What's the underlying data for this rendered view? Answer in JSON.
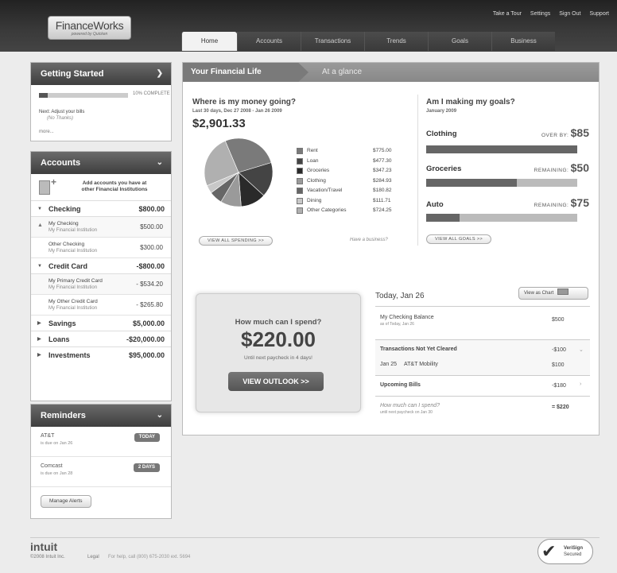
{
  "header": {
    "logo_brand": "FinanceWorks",
    "logo_sub": "powered by Quicken",
    "top_links": [
      "Take a Tour",
      "Settings",
      "Sign Out",
      "Support"
    ],
    "tabs": [
      "Home",
      "Accounts",
      "Transactions",
      "Trends",
      "Goals",
      "Business"
    ]
  },
  "getting_started": {
    "title": "Getting Started",
    "percent": 10,
    "percent_label": "10% COMPLETE",
    "next_label": "Next: Adjust your bills",
    "next_sub": "(No Thanks)",
    "more": "more..."
  },
  "accounts": {
    "title": "Accounts",
    "add_text_1": "Add accounts you have at",
    "add_text_2": "other Financial Institutions",
    "checking": {
      "name": "Checking",
      "amount": "$800.00",
      "subs": [
        {
          "name": "My Checking",
          "inst": "My Financial Institution",
          "amount": "$500.00"
        },
        {
          "name": "Other Checking",
          "inst": "My Financial Institution",
          "amount": "$300.00"
        }
      ]
    },
    "credit": {
      "name": "Credit Card",
      "amount": "-$800.00",
      "subs": [
        {
          "name": "My Primary Credit Card",
          "inst": "My Financial Institution",
          "amount": "- $534.20"
        },
        {
          "name": "My Other Credit Card",
          "inst": "My Financial Institution",
          "amount": "- $265.80"
        }
      ]
    },
    "savings": {
      "name": "Savings",
      "amount": "$5,000.00"
    },
    "loans": {
      "name": "Loans",
      "amount": "-$20,000.00"
    },
    "investments": {
      "name": "Investments",
      "amount": "$95,000.00"
    }
  },
  "reminders": {
    "title": "Reminders",
    "items": [
      {
        "name": "AT&T",
        "due": "is due on Jan 26",
        "badge": "TODAY"
      },
      {
        "name": "Comcast",
        "due": "is due on Jan 28",
        "badge": "2 DAYS"
      }
    ],
    "manage": "Manage Alerts"
  },
  "main": {
    "tab1": "Your Financial Life",
    "tab2": "At a glance",
    "spending": {
      "title": "Where is my money going?",
      "range": "Last 30 days, Dec 27 2008 - Jan 26 2009",
      "total": "$2,901.33",
      "view_all": "VIEW ALL SPENDING >>",
      "business": "Have a business?"
    },
    "goals": {
      "title": "Am I making my goals?",
      "month": "January 2009",
      "items": [
        {
          "name": "Clothing",
          "status": "OVER BY:",
          "amount": "$85",
          "fill": 1.0
        },
        {
          "name": "Groceries",
          "status": "REMAINING:",
          "amount": "$50",
          "fill": 0.6
        },
        {
          "name": "Auto",
          "status": "REMAINING:",
          "amount": "$75",
          "fill": 0.22
        }
      ],
      "view_all": "VIEW ALL GOALS >>"
    },
    "spend_box": {
      "question": "How much can I spend?",
      "amount": "$220.00",
      "until": "Until next paycheck in 4 days!",
      "button": "VIEW OUTLOOK >>"
    },
    "today": {
      "title": "Today, Jan 26",
      "view_chart": "View as Chart",
      "balance_label": "My Checking Balance",
      "balance_sub": "as of Today, Jan 26",
      "balance_amount": "$500",
      "not_cleared": "Transactions Not Yet Cleared",
      "not_cleared_amount": "-$100",
      "tx_date": "Jan 25",
      "tx_name": "AT&T Mobility",
      "tx_amount": "$100",
      "upcoming": "Upcoming Bills",
      "upcoming_amount": "-$180",
      "how_much": "How much can I spend?",
      "how_much_sub": "until next paycheck on Jan 30",
      "how_much_amount": "= $220"
    }
  },
  "chart_data": {
    "type": "pie",
    "categories": [
      "Rent",
      "Loan",
      "Groceries",
      "Clothing",
      "Vacation/Travel",
      "Dining",
      "Other Categories"
    ],
    "values": [
      775.0,
      477.3,
      347.23,
      284.93,
      180.82,
      111.71,
      724.25
    ],
    "labels": [
      "$775.00",
      "$477.30",
      "$347.23",
      "$284.93",
      "$180.82",
      "$111.71",
      "$724.25"
    ],
    "colors": [
      "#7a7a7a",
      "#444444",
      "#2a2a2a",
      "#9a9a9a",
      "#666666",
      "#c8c8c8",
      "#b0b0b0"
    ]
  },
  "footer": {
    "brand": "intuit",
    "copyright": "©2008 Intuit Inc.",
    "legal": "Legal",
    "help": "For help, call (800) 675-2030 ext. 5694",
    "seal_1": "VeriSign",
    "seal_2": "Secured"
  }
}
